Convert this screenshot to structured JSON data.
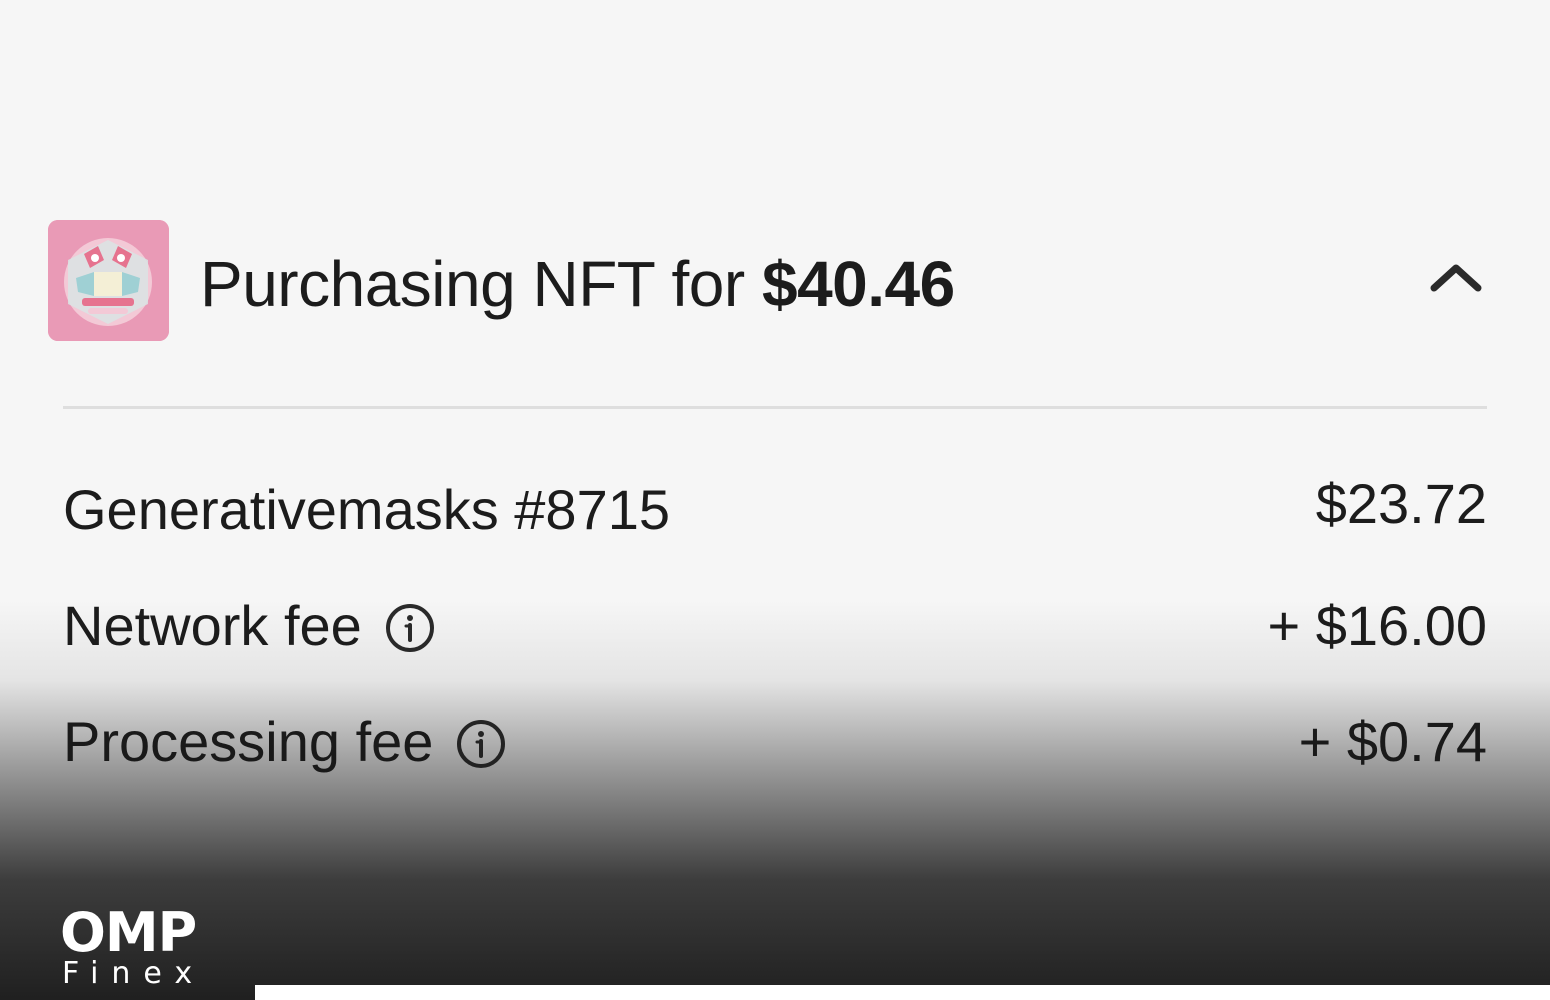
{
  "header": {
    "title_prefix": "Purchasing NFT for ",
    "title_amount": "$40.46",
    "thumbnail_icon": "nft-mask-thumbnail",
    "collapse_icon": "chevron-up-icon"
  },
  "summary": {
    "rows": [
      {
        "label": "Generativemasks #8715",
        "value": "$23.72",
        "has_info": false
      },
      {
        "label": "Network fee",
        "value": "+ $16.00",
        "has_info": true
      },
      {
        "label": "Processing fee",
        "value": "+ $0.74",
        "has_info": true
      }
    ]
  },
  "watermark": {
    "main": "OMP",
    "sub": "Finex"
  },
  "colors": {
    "background": "#f6f6f6",
    "text": "#1c1c1c",
    "thumbnail_bg": "#e99ab6",
    "divider": "#dedede",
    "watermark": "#ffffff"
  }
}
